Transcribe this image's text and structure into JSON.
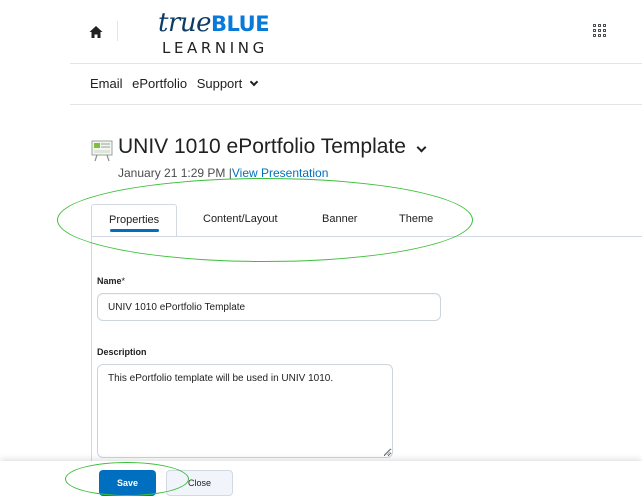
{
  "header": {
    "logo_line1_a": "true",
    "logo_line1_b": "BLUE",
    "logo_line2": "LEARNING"
  },
  "nav": {
    "items": [
      "Email",
      "ePortfolio",
      "Support"
    ]
  },
  "presentation": {
    "title": "UNIV 1010 ePortfolio Template",
    "date": "January 21 1:29 PM",
    "separator": "|",
    "view_link": "View Presentation"
  },
  "tabs": [
    {
      "label": "Properties",
      "active": true
    },
    {
      "label": "Content/Layout",
      "active": false
    },
    {
      "label": "Banner",
      "active": false
    },
    {
      "label": "Theme",
      "active": false
    }
  ],
  "form": {
    "name_label": "Name",
    "required_mark": "*",
    "name_value": "UNIV 1010 ePortfolio Template",
    "description_label": "Description",
    "description_value": "This ePortfolio template will be used in UNIV 1010."
  },
  "footer": {
    "save_label": "Save",
    "close_label": "Close"
  },
  "colors": {
    "accent": "#006fbf",
    "annotation": "#3cbf3a",
    "logo_dark": "#0d3b66",
    "logo_blue": "#0a7ad8"
  }
}
